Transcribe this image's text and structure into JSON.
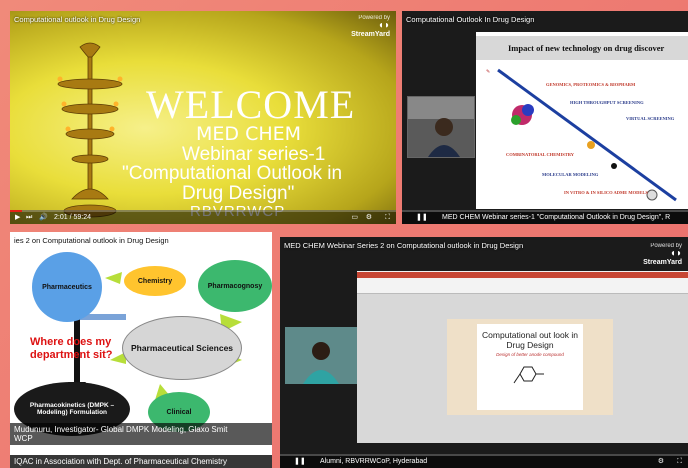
{
  "brand": {
    "powered_by": "Powered by",
    "name": "StreamYard"
  },
  "tiles": [
    {
      "title": "Computational outlook in Drug Design",
      "welcome": [
        "WELCOME",
        "MED CHEM",
        "Webinar series-1",
        "\"Computational Outlook in",
        "Drug Design\"",
        "RBVRRWCP"
      ],
      "time": "2:01 / 59:24",
      "progress": 0.03
    },
    {
      "title": "Computational Outlook In Drug Design",
      "slide_title": "Impact of new technology on drug discover",
      "slide_items": [
        "GENOMICS, PROTEOMICS & BIOPHARM",
        "HIGH THROUGHPUT SCREENING",
        "VIRTUAL SCREENING",
        "COMBINATORIAL CHEMISTRY",
        "MOLECULAR MODELING",
        "IN VITRO & IN SILICO ADME MODELS"
      ],
      "bottom_text": "MED CHEM Webinar series-1 \"Computational Outlook in Drug Design\", R"
    },
    {
      "title": "ies 2 on Computational outlook in Drug Design",
      "nodes": [
        "Pharmaceutics",
        "Chemistry",
        "Pharmacognosy",
        "Pharmaceutical Sciences",
        "Pharmacokinetics (DMPK – Modeling) Formulation",
        "Clinical"
      ],
      "question": "Where does my department sit?",
      "caption1": "Mudunuru, Investigator- Global DMPK Modeling, Glaxo Smit",
      "caption1b": "WCP",
      "caption2": "IQAC in Association with Dept. of Pharmaceutical Chemistry"
    },
    {
      "title": "MED CHEM Webinar Series 2 on Computational outlook in Drug Design",
      "slide_title": [
        "Computational out look in",
        "Drug Design"
      ],
      "slide_sub": "Design of better anode compound",
      "bottom_text": "Alumni, RBVRRWCoP, Hyderabad"
    }
  ]
}
